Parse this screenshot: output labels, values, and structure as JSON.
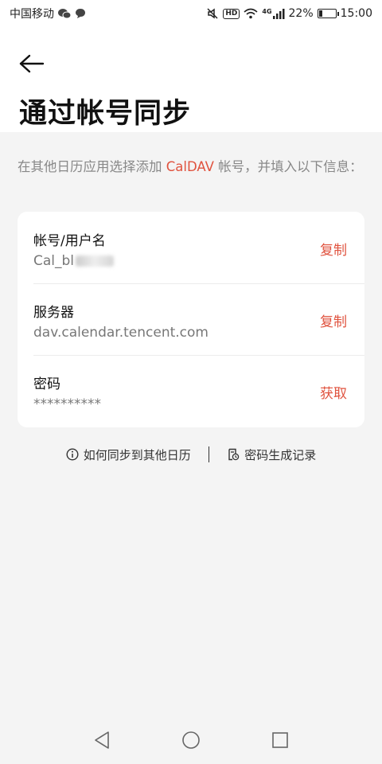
{
  "status_bar": {
    "carrier": "中国移动",
    "network_label": "4G",
    "battery_percent": 22,
    "battery_text": "22%",
    "time": "15:00"
  },
  "header": {
    "title": "通过帐号同步"
  },
  "instruction": {
    "before": "在其他日历应用选择添加 ",
    "highlight": "CalDAV",
    "after": " 帐号，并填入以下信息："
  },
  "rows": [
    {
      "label": "帐号/用户名",
      "value": "Cal_bl",
      "action": "复制"
    },
    {
      "label": "服务器",
      "value": "dav.calendar.tencent.com",
      "action": "复制"
    },
    {
      "label": "密码",
      "value": "**********",
      "action": "获取"
    }
  ],
  "links": {
    "help": "如何同步到其他日历",
    "history": "密码生成记录"
  },
  "colors": {
    "accent": "#e0533f",
    "background": "#f4f4f4",
    "card": "#ffffff"
  },
  "icons": [
    "back-arrow-icon",
    "info-icon",
    "record-icon",
    "nav-back-icon",
    "nav-home-icon",
    "nav-recent-icon"
  ]
}
